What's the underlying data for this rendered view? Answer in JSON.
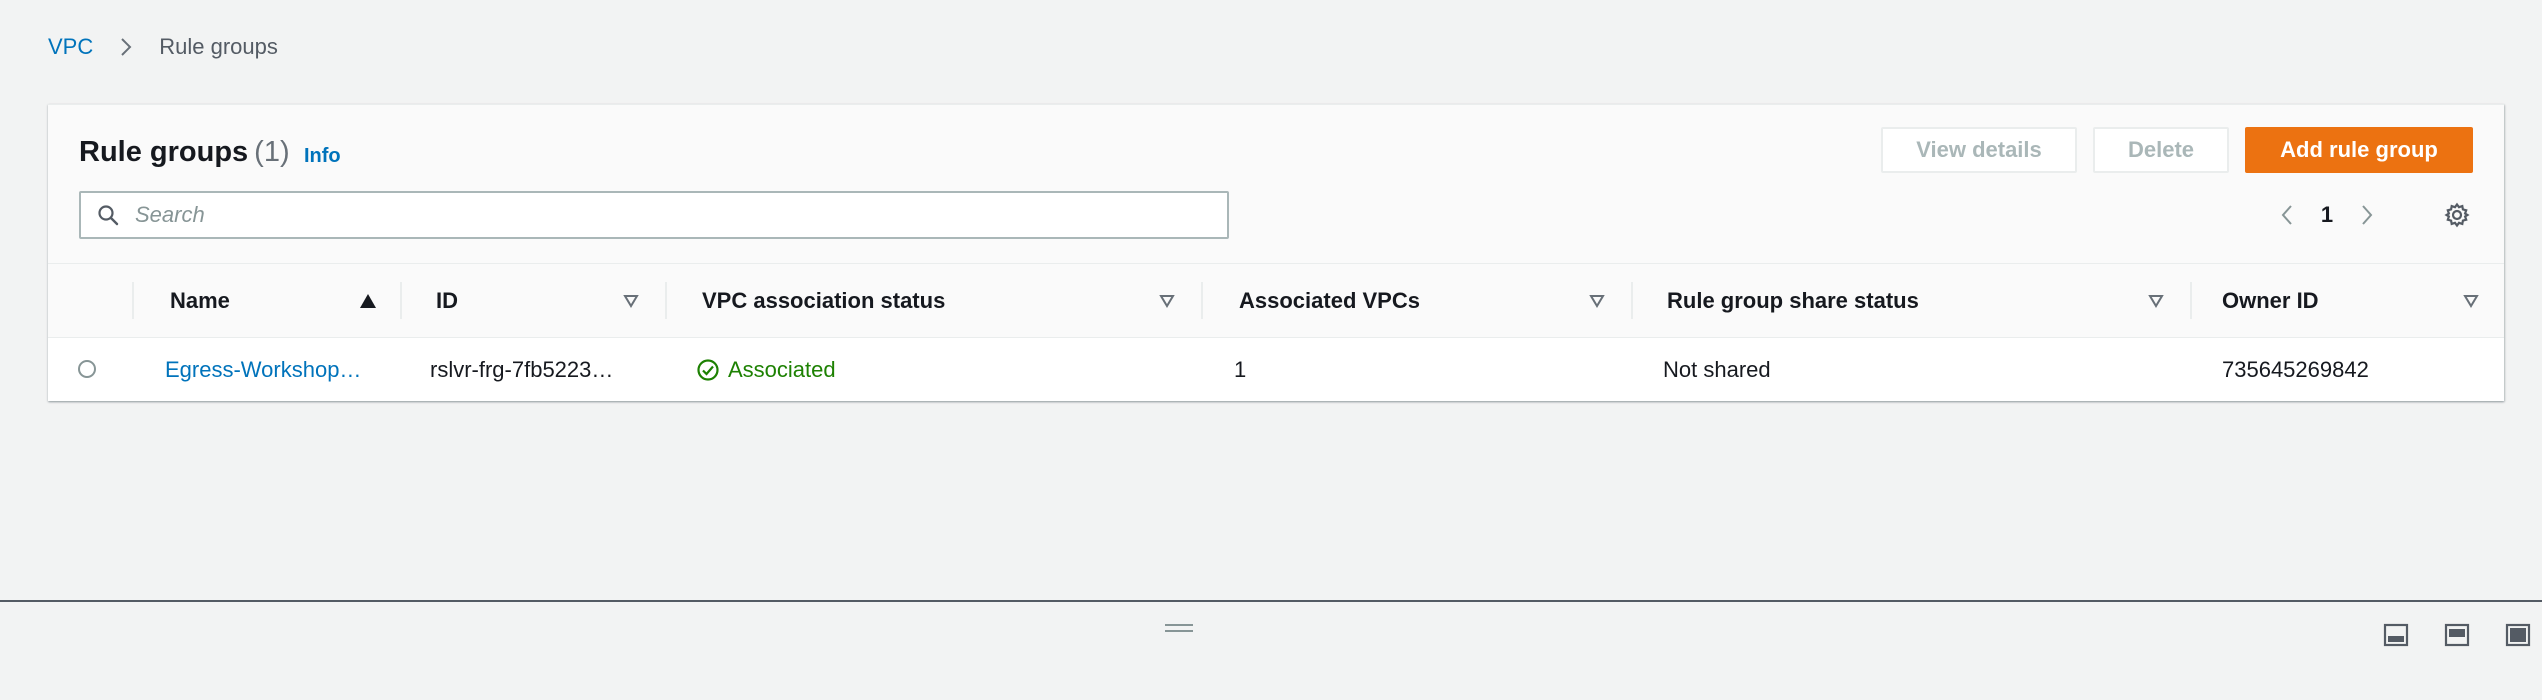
{
  "breadcrumb": {
    "root": "VPC",
    "current": "Rule groups"
  },
  "header": {
    "title": "Rule groups",
    "count": "(1)",
    "info": "Info"
  },
  "actions": {
    "view_details": "View details",
    "delete": "Delete",
    "add_rule_group": "Add rule group"
  },
  "search": {
    "placeholder": "Search",
    "value": ""
  },
  "pagination": {
    "current_page": "1"
  },
  "table": {
    "columns": [
      {
        "label": "Name",
        "sort": "ascending"
      },
      {
        "label": "ID",
        "sort": "none"
      },
      {
        "label": "VPC association status",
        "sort": "none"
      },
      {
        "label": "Associated VPCs",
        "sort": "none"
      },
      {
        "label": "Rule group share status",
        "sort": "none"
      },
      {
        "label": "Owner ID",
        "sort": "none"
      }
    ],
    "rows": [
      {
        "name": "Egress-Workshop…",
        "id": "rslvr-frg-7fb5223…",
        "vpc_association_status": "Associated",
        "associated_vpcs": "1",
        "share_status": "Not shared",
        "owner_id": "735645269842"
      }
    ]
  },
  "colors": {
    "link": "#0073bb",
    "primary": "#ec7211",
    "success": "#1d8102",
    "background": "#f2f3f3"
  },
  "icons": {
    "breadcrumb_separator": "chevron-right-icon",
    "search": "search-icon",
    "pager_prev": "chevron-left-icon",
    "pager_next": "chevron-right-icon",
    "settings": "gear-icon",
    "status": "check-circle-icon",
    "split_panel_positions": [
      "panel-bottom-icon",
      "panel-side-icon",
      "panel-full-icon"
    ]
  }
}
